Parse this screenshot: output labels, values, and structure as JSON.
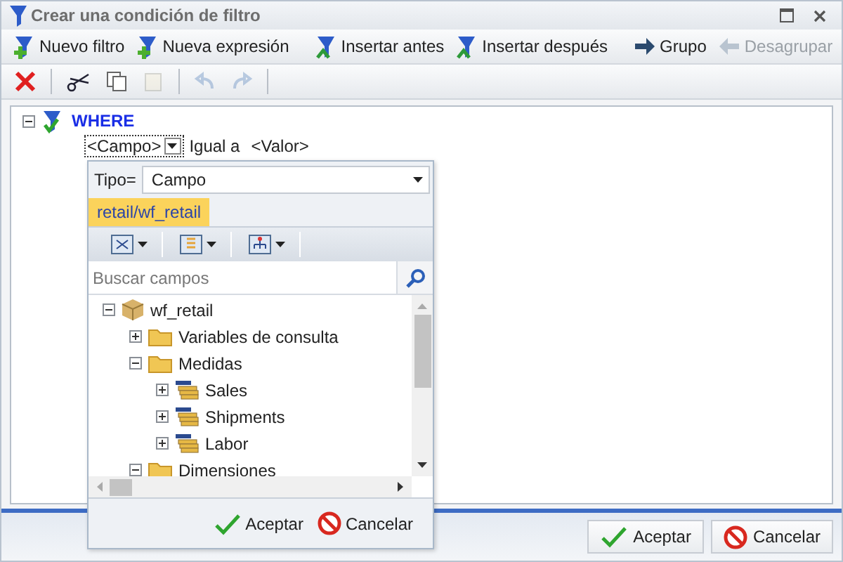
{
  "window": {
    "title": "Crear una condición de filtro"
  },
  "toolbar": [
    [
      {
        "label": "Nuevo filtro",
        "kind": "filter-add",
        "disabled": false
      },
      {
        "label": "Nueva expresión",
        "kind": "filter-add",
        "disabled": false
      }
    ],
    [
      {
        "label": "Insertar antes",
        "kind": "filter-insert",
        "disabled": false
      },
      {
        "label": "Insertar después",
        "kind": "filter-insert",
        "disabled": false
      }
    ],
    [
      {
        "label": "Grupo",
        "kind": "arrow",
        "disabled": false
      },
      {
        "label": "Desagrupar",
        "kind": "arrow-left",
        "disabled": true
      }
    ]
  ],
  "edit_toolbar": [
    [
      {
        "kind": "delete",
        "disabled": false
      }
    ],
    [
      {
        "kind": "cut",
        "disabled": false
      },
      {
        "kind": "copy",
        "disabled": false
      },
      {
        "kind": "paste",
        "disabled": true
      }
    ],
    [
      {
        "kind": "undo",
        "disabled": true
      },
      {
        "kind": "redo",
        "disabled": true
      }
    ]
  ],
  "condition": {
    "keyword": "WHERE",
    "expanded": true,
    "field": "<Campo>",
    "operator": "Igual a",
    "value": "<Valor>"
  },
  "picker": {
    "type_label": "Tipo=",
    "type_value": "Campo",
    "source_tab": "retail/wf_retail",
    "view_buttons": [
      {
        "kind": "diagram"
      },
      {
        "kind": "list"
      },
      {
        "kind": "hierarchy"
      }
    ],
    "search": {
      "placeholder": "Buscar campos"
    },
    "tree": [
      {
        "label": "wf_retail",
        "kind": "cube",
        "expanded": true,
        "children": [
          {
            "label": "Variables de consulta",
            "kind": "folder",
            "expanded": false
          },
          {
            "label": "Medidas",
            "kind": "folder",
            "expanded": true,
            "children": [
              {
                "label": "Sales",
                "kind": "measure",
                "expanded": false
              },
              {
                "label": "Shipments",
                "kind": "measure",
                "expanded": false
              },
              {
                "label": "Labor",
                "kind": "measure",
                "expanded": false
              }
            ]
          },
          {
            "label": "Dimensiones",
            "kind": "folder",
            "expanded": true
          }
        ]
      }
    ],
    "buttons": [
      {
        "label": "Aceptar",
        "kind": "ok"
      },
      {
        "label": "Cancelar",
        "kind": "cancel"
      }
    ]
  },
  "buttons": [
    {
      "label": "Aceptar",
      "kind": "ok"
    },
    {
      "label": "Cancelar",
      "kind": "cancel"
    }
  ]
}
